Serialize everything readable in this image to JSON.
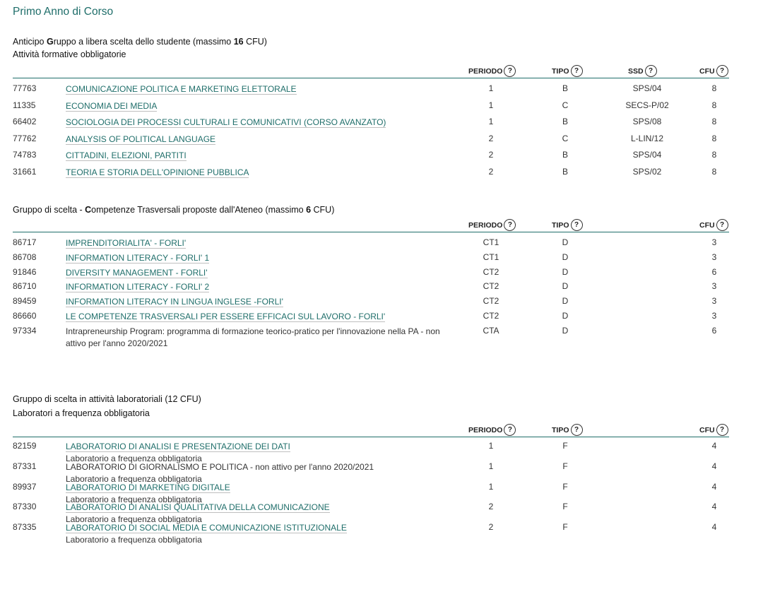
{
  "year_title": "Primo Anno di Corso",
  "headers": {
    "periodo": "PERIODO",
    "tipo": "TIPO",
    "ssd": "SSD",
    "cfu": "CFU",
    "help": "?"
  },
  "group1": {
    "title_pre": "Anticipo ",
    "title_bold": "G",
    "title_post": "ruppo a libera scelta dello studente (massimo ",
    "title_num": "16",
    "title_end": " CFU)",
    "subtitle": "Attività formative obbligatorie",
    "rows": [
      {
        "code": "77763",
        "name": "COMUNICAZIONE POLITICA E MARKETING ELETTORALE",
        "periodo": "1",
        "tipo": "B",
        "ssd": "SPS/04",
        "cfu": "8"
      },
      {
        "code": "11335",
        "name": "ECONOMIA DEI MEDIA",
        "periodo": "1",
        "tipo": "C",
        "ssd": "SECS-P/02",
        "cfu": "8"
      },
      {
        "code": "66402",
        "name": "SOCIOLOGIA DEI PROCESSI CULTURALI E COMUNICATIVI (CORSO AVANZATO)",
        "periodo": "1",
        "tipo": "B",
        "ssd": "SPS/08",
        "cfu": "8"
      },
      {
        "code": "77762",
        "name": "ANALYSIS OF POLITICAL LANGUAGE",
        "periodo": "2",
        "tipo": "C",
        "ssd": "L-LIN/12",
        "cfu": "8"
      },
      {
        "code": "74783",
        "name": "CITTADINI, ELEZIONI, PARTITI",
        "periodo": "2",
        "tipo": "B",
        "ssd": "SPS/04",
        "cfu": "8"
      },
      {
        "code": "31661",
        "name": "TEORIA E STORIA DELL'OPINIONE PUBBLICA",
        "periodo": "2",
        "tipo": "B",
        "ssd": "SPS/02",
        "cfu": "8"
      }
    ]
  },
  "group2": {
    "title_pre": "Gruppo di scelta - ",
    "title_bold": "C",
    "title_post": "ompetenze Trasversali proposte dall'Ateneo (massimo ",
    "title_num": "6",
    "title_end": " CFU)",
    "rows": [
      {
        "code": "86717",
        "name": "IMPRENDITORIALITA' - FORLI'",
        "periodo": "CT1",
        "tipo": "D",
        "cfu": "3",
        "link": true
      },
      {
        "code": "86708",
        "name": "INFORMATION LITERACY - FORLI' 1",
        "periodo": "CT1",
        "tipo": "D",
        "cfu": "3",
        "link": true
      },
      {
        "code": "91846",
        "name": "DIVERSITY MANAGEMENT - FORLI'",
        "periodo": "CT2",
        "tipo": "D",
        "cfu": "6",
        "link": true
      },
      {
        "code": "86710",
        "name": "INFORMATION LITERACY - FORLI' 2",
        "periodo": "CT2",
        "tipo": "D",
        "cfu": "3",
        "link": true
      },
      {
        "code": "89459",
        "name": "INFORMATION LITERACY IN LINGUA INGLESE -FORLI'",
        "periodo": "CT2",
        "tipo": "D",
        "cfu": "3",
        "link": true
      },
      {
        "code": "86660",
        "name": "LE COMPETENZE TRASVERSALI PER ESSERE EFFICACI SUL LAVORO - FORLI'",
        "periodo": "CT2",
        "tipo": "D",
        "cfu": "3",
        "link": true
      },
      {
        "code": "97334",
        "name": "Intrapreneurship Program: programma di formazione teorico-pratico per l'innovazione nella PA - non attivo per l'anno  2020/2021",
        "periodo": "CTA",
        "tipo": "D",
        "cfu": "6",
        "link": false
      }
    ]
  },
  "group3": {
    "title_pre": "Gruppo di scelta in attività laboratoriali (12 CFU)",
    "subtitle": "Laboratori a frequenza obbligatoria",
    "rows": [
      {
        "code": "82159",
        "name": "LABORATORIO DI ANALISI E PRESENTAZIONE DEI DATI",
        "note": "Laboratorio a frequenza obbligatoria",
        "periodo": "1",
        "tipo": "F",
        "cfu": "4",
        "link": true
      },
      {
        "code": "87331",
        "name": "LABORATORIO DI GIORNALISMO E POLITICA - non attivo per l'anno  2020/2021",
        "note": "Laboratorio a frequenza obbligatoria",
        "periodo": "1",
        "tipo": "F",
        "cfu": "4",
        "link": false
      },
      {
        "code": "89937",
        "name": "LABORATORIO DI MARKETING DIGITALE",
        "note": "Laboratorio a frequenza obbligatoria",
        "periodo": "1",
        "tipo": "F",
        "cfu": "4",
        "link": true
      },
      {
        "code": "87330",
        "name": "LABORATORIO DI ANALISI QUALITATIVA DELLA COMUNICAZIONE",
        "note": "Laboratorio a frequenza obbligatoria",
        "periodo": "2",
        "tipo": "F",
        "cfu": "4",
        "link": true
      },
      {
        "code": "87335",
        "name": "LABORATORIO DI SOCIAL MEDIA E COMUNICAZIONE ISTITUZIONALE",
        "note": "Laboratorio a frequenza obbligatoria",
        "periodo": "2",
        "tipo": "F",
        "cfu": "4",
        "link": true
      }
    ]
  }
}
